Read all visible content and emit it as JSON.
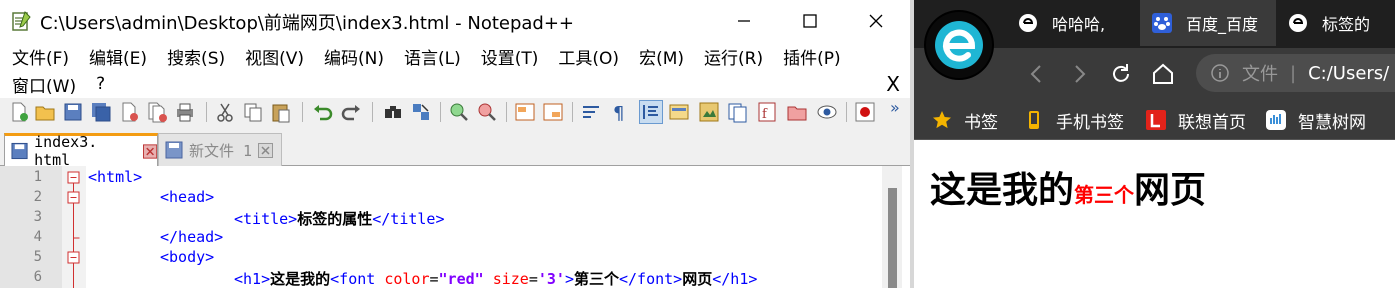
{
  "npp": {
    "title": "C:\\Users\\admin\\Desktop\\前端网页\\index3.html - Notepad++",
    "menu_row1": [
      "文件(F)",
      "编辑(E)",
      "搜索(S)",
      "视图(V)",
      "编码(N)",
      "语言(L)",
      "设置(T)",
      "工具(O)",
      "宏(M)",
      "运行(R)",
      "插件(P)"
    ],
    "menu_row2": [
      "窗口(W)",
      "?"
    ],
    "menu_close": "X",
    "tabs": [
      {
        "label": "index3. html",
        "active": true
      },
      {
        "label": "新文件 1",
        "active": false
      }
    ],
    "line_numbers": [
      "1",
      "2",
      "3",
      "4",
      "5",
      "6"
    ],
    "code": {
      "l1_tag": "<html>",
      "l2_tag": "<head>",
      "l3_open": "<title>",
      "l3_text": "标签的属性",
      "l3_close": "</title>",
      "l4_tag": "</head>",
      "l5_tag": "<body>",
      "l6_h1open": "<h1>",
      "l6_text1": "这是我的",
      "l6_font_open": "<font ",
      "l6_attr_color": "color",
      "l6_eq1": "=",
      "l6_val_color": "\"red\"",
      "l6_attr_size": " size",
      "l6_eq2": "=",
      "l6_val_size": "'3'",
      "l6_gt": ">",
      "l6_text2": "第三个",
      "l6_font_close": "</font>",
      "l6_text3": "网页",
      "l6_h1close": "</h1>"
    },
    "colors": {
      "tag": "#0000ff",
      "attr": "#ff0000",
      "string": "#8000ff",
      "active_tab_accent": "#f39c12"
    }
  },
  "browser": {
    "tabs": [
      {
        "label": "哈哈哈,",
        "icon": "app-icon"
      },
      {
        "label": "百度_百度",
        "icon": "baidu-paw-icon"
      },
      {
        "label": "标签的",
        "icon": "app-icon"
      }
    ],
    "address": {
      "prefix": "文件",
      "url": "C:/Users/"
    },
    "bookmarks": [
      {
        "label": "书签",
        "icon": "star-icon"
      },
      {
        "label": "手机书签",
        "icon": "phone-icon"
      },
      {
        "label": "联想首页",
        "icon": "lenovo-icon"
      },
      {
        "label": "智慧树网",
        "icon": "zhihuishu-icon"
      }
    ],
    "page": {
      "h1_part1": "这是我的",
      "h1_red": "第三个",
      "h1_part2": "网页"
    },
    "colors": {
      "tab_strip": "#1f1f1f",
      "toolbar": "#3a3a3a",
      "red_text": "#ff0000"
    }
  }
}
